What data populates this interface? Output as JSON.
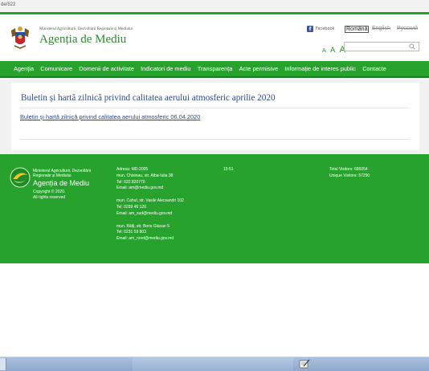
{
  "browser": {
    "url_fragment": "de/522"
  },
  "header": {
    "ministry": "Ministerul Agriculturii, Dezvoltării Regionale și Mediului",
    "agency": "Agenția de Mediu",
    "facebook_label": "Facebook",
    "languages": [
      "Română",
      "English",
      "Русский"
    ],
    "font_sizes": [
      "A",
      "A",
      "A"
    ],
    "search_placeholder": "",
    "brand_color": "#27a22d"
  },
  "nav": {
    "items": [
      "Agenţia",
      "Comunicare",
      "Domenii de activitate",
      "Indicatori de mediu",
      "Transparența",
      "Acte permisive",
      "Informație de interes public",
      "Contacte"
    ]
  },
  "main": {
    "title": "Buletin și hartă zilnică privind calitatea aerului atmosferic aprilie 2020",
    "link": "Buletin și hartă zilnică privind calitatea aerului atmosferic 06.04.2020",
    "title_color": "#2c4a8e"
  },
  "footer": {
    "ministry": "Ministerul Agriculturii, Dezvoltării Regionale și Mediului",
    "agency": "Agenția de Mediu",
    "copyright": "Copyright © 2020.",
    "rights": "All rights reserved",
    "address_lines": [
      "Adresa: MD-2005",
      "mun. Chisinau, str. Alba-Iulia 38",
      "Tel: 022 820770",
      "Email: am@mediu.gov.md"
    ],
    "south_lines": [
      "mun. Cahul, str. Vasile Alecsandri 102",
      "Tel: 0299 46 126",
      "Email: am_sud@mediu.gov.md"
    ],
    "north_lines": [
      "mun. Bălți, str. Boris Glavan 5",
      "Tel: 0231 59 803",
      "Email: am_nord@mediu.gov.md"
    ],
    "time": "15:51",
    "total_visitors": "Total Visitors: 686054",
    "unique_visitors": "Unique Visitors: 57290"
  }
}
